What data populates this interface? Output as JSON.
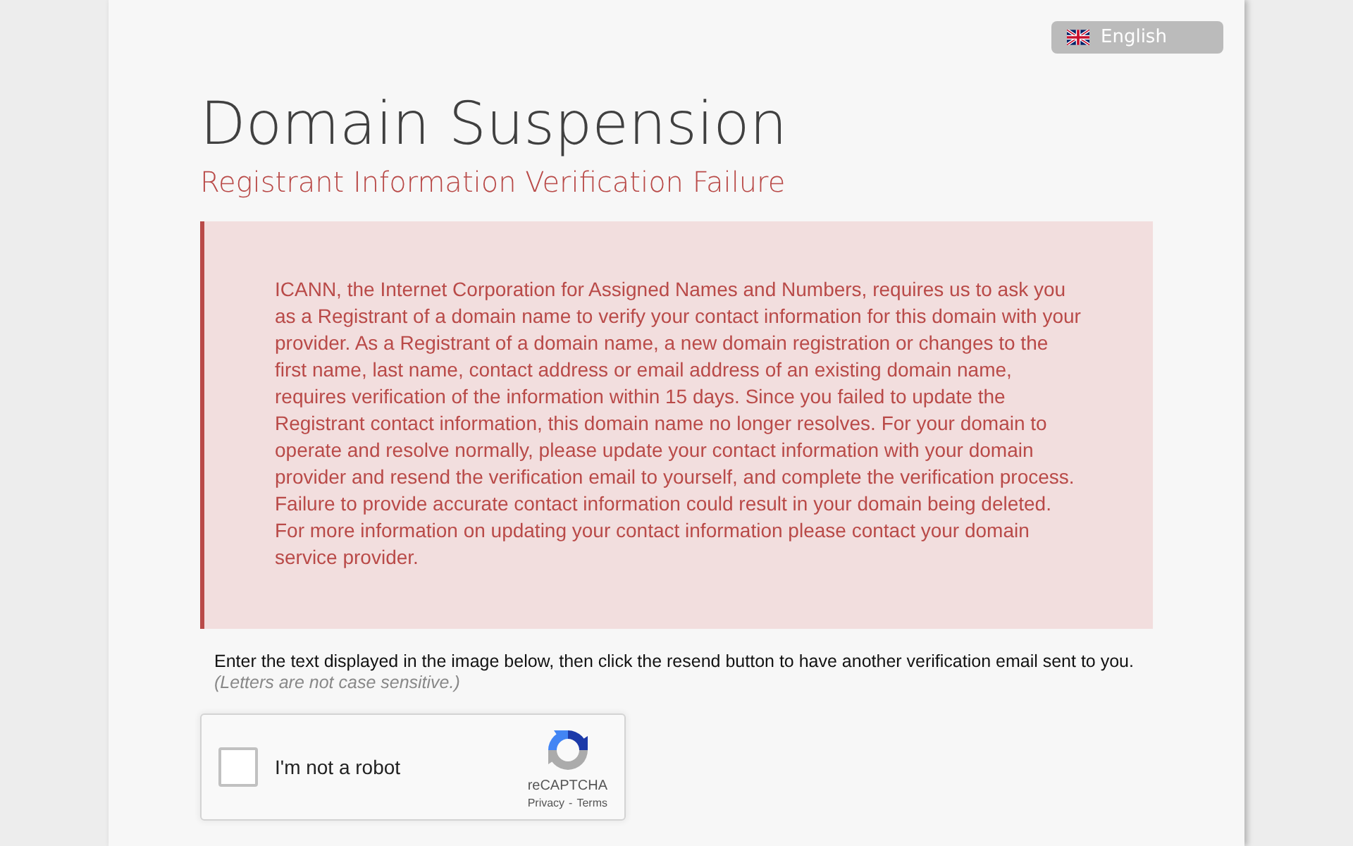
{
  "language_button": {
    "label": "English"
  },
  "heading": {
    "title": "Domain Suspension",
    "subtitle": "Registrant Information Verification Failure"
  },
  "alert": {
    "text": "ICANN, the Internet Corporation for Assigned Names and Numbers, requires us to ask you as a Registrant of a domain name to verify your contact information for this domain with your provider. As a Registrant of a domain name, a new domain registration or changes to the first name, last name, contact address or email address of an existing domain name, requires verification of the information within 15 days. Since you failed to update the Registrant contact information, this domain name no longer resolves. For your domain to operate and resolve normally, please update your contact information with your domain provider and resend the verification email to yourself, and complete the verification process. Failure to provide accurate contact information could result in your domain being deleted. For more information on updating your contact information please contact your domain service provider."
  },
  "instructions": {
    "text": "Enter the text displayed in the image below, then click the resend button to have another verification email sent to you.",
    "note": "(Letters are not case sensitive.)"
  },
  "captcha": {
    "label": "I'm not a robot",
    "checked": false,
    "brand": "reCAPTCHA",
    "links": [
      {
        "label": "Privacy"
      },
      {
        "label": "Terms"
      }
    ],
    "separator": "-"
  }
}
